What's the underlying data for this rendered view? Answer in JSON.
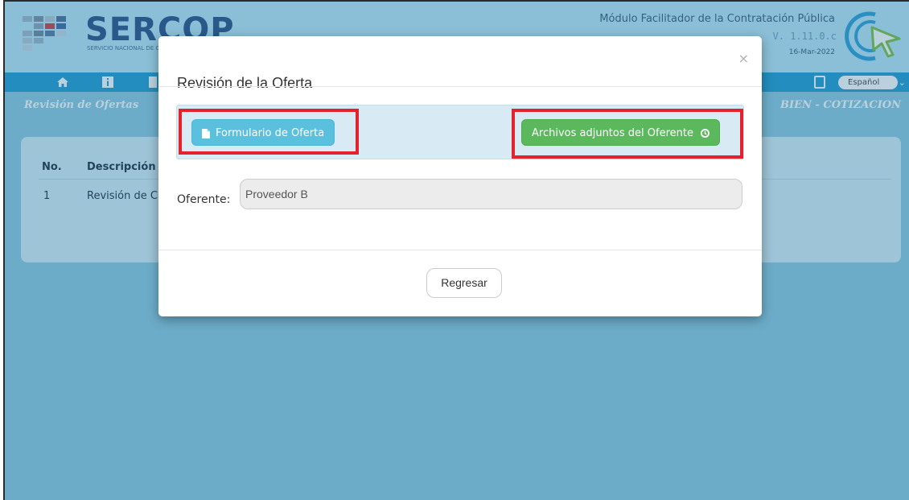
{
  "header": {
    "brand": "SERCOP",
    "brand_sub": "SERVICIO NACIONAL DE C",
    "app_title": "Módulo Facilitador de la Contratación Pública",
    "version": "V. 1.11.0.c",
    "date": "16-Mar-2022"
  },
  "navbar": {
    "language": "Español"
  },
  "subbar": {
    "left": "Revisión de Ofertas",
    "right": "BIEN - COTIZACION"
  },
  "table": {
    "headers": [
      "No.",
      "Descripción"
    ],
    "rows": [
      {
        "no": "1",
        "descripcion": "Revisión de C"
      }
    ]
  },
  "modal": {
    "title": "Revisión de la Oferta",
    "close_glyph": "×",
    "form_button": "Formulario de Oferta",
    "attachments_button": "Archivos adjuntos del Oferente",
    "oferente_label": "Oferente:",
    "oferente_value": "Proveedor B",
    "back_button": "Regresar"
  },
  "colors": {
    "highlight": "#e3222d",
    "info": "#5bc0de",
    "success": "#5cb85c",
    "navbar": "#1f9cd2"
  },
  "icons": [
    "home-icon",
    "info-icon",
    "document-icon",
    "file-icon",
    "clock-icon",
    "pdf-icon"
  ]
}
